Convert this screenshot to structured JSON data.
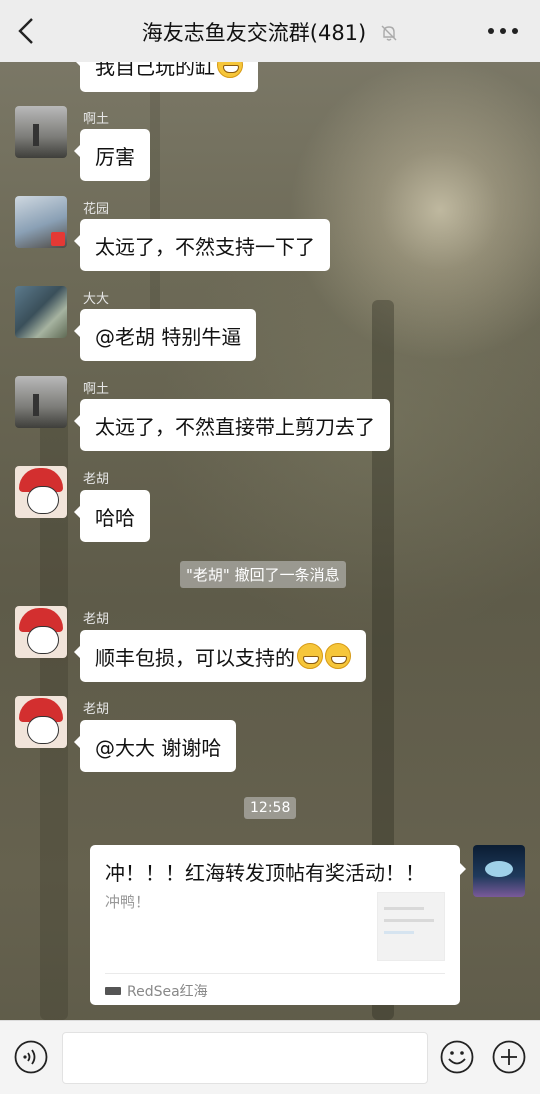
{
  "header": {
    "title": "海友志鱼友交流群(481)",
    "back_icon": "chevron-left-icon",
    "mute_icon": "bell-muted-icon",
    "more_icon": "more-dots-icon"
  },
  "messages": [
    {
      "sender": "",
      "text": "我自己玩的缸"
    },
    {
      "sender": "啊土",
      "text": "厉害"
    },
    {
      "sender": "花园",
      "text": "太远了，不然支持一下了"
    },
    {
      "sender": "大大",
      "text": "@老胡  特别牛逼"
    },
    {
      "sender": "啊土",
      "text": "太远了，不然直接带上剪刀去了"
    },
    {
      "sender": "老胡",
      "text": "哈哈"
    },
    {
      "system": "\"老胡\" 撤回了一条消息"
    },
    {
      "sender": "老胡",
      "text": "顺丰包损，可以支持的"
    },
    {
      "sender": "老胡",
      "text": "@大大  谢谢哈"
    },
    {
      "time": "12:58"
    }
  ],
  "share_card": {
    "title": "冲！！！红海转发顶帖有奖活动！！",
    "description": "冲鸭！",
    "source": "RedSea红海"
  },
  "bottom": {
    "voice_icon": "voice-icon",
    "emoji_icon": "emoji-icon",
    "plus_icon": "plus-icon",
    "input_value": ""
  }
}
